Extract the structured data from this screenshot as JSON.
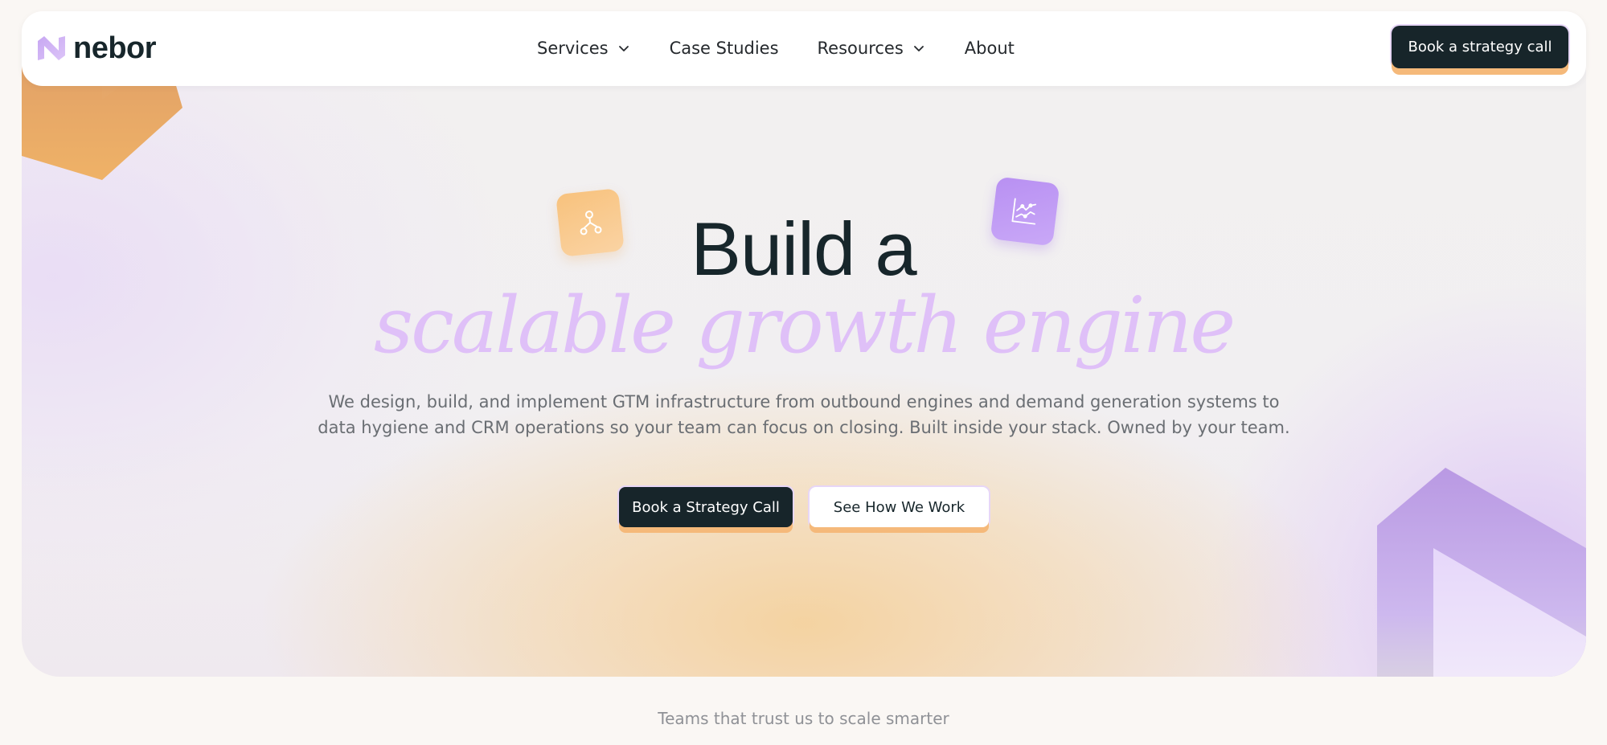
{
  "brand": {
    "name": "nebor",
    "logo_icon": "nebor-logo-mark",
    "accent_purple": "#dfc0f8",
    "accent_orange": "#f5b97a",
    "dark": "#17252a"
  },
  "nav": {
    "items": [
      {
        "label": "Services",
        "has_dropdown": true,
        "icon": "chevron-down-icon"
      },
      {
        "label": "Case Studies",
        "has_dropdown": false
      },
      {
        "label": "Resources",
        "has_dropdown": true,
        "icon": "chevron-down-icon"
      },
      {
        "label": "About",
        "has_dropdown": false
      }
    ],
    "cta_label": "Book a strategy call"
  },
  "hero": {
    "headline": "Build a",
    "headline_accent": "scalable growth engine",
    "subcopy": "We design, build, and implement GTM infrastructure from outbound engines and demand generation systems to data hygiene and CRM operations so your team can focus on closing. Built inside your stack. Owned by your team.",
    "primary_cta": "Book a Strategy Call",
    "secondary_cta": "See How We Work",
    "floating_icons": [
      "workflow-icon",
      "line-chart-icon"
    ]
  },
  "trust": {
    "heading": "Teams that trust us to scale smarter"
  }
}
